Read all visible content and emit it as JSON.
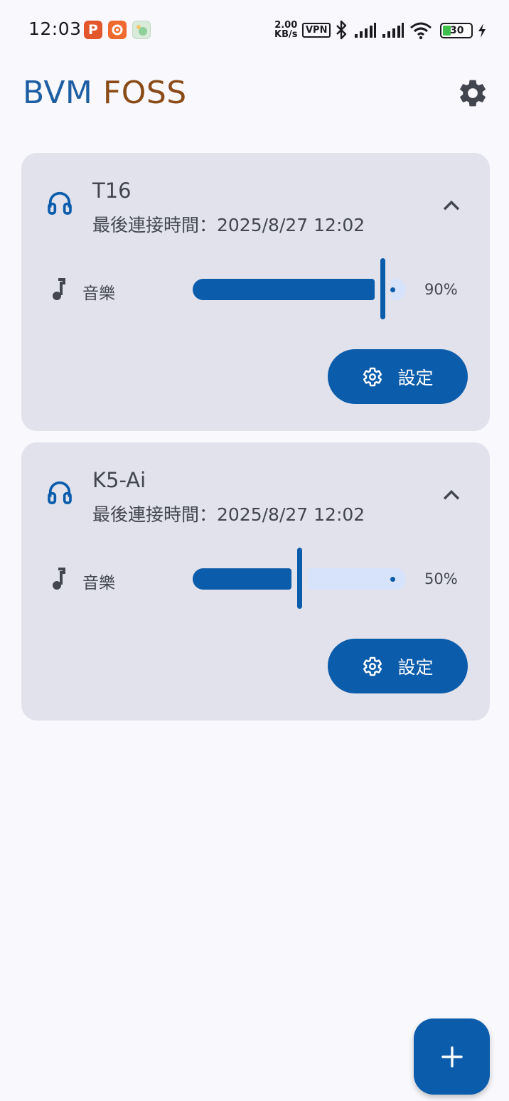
{
  "status_bar": {
    "time": "12:03",
    "net_speed_value": "2.00",
    "net_speed_unit": "KB/s",
    "vpn_label": "VPN",
    "battery": "30",
    "app_icon_1_letter": "P"
  },
  "app_bar": {
    "title_part1": "BVM",
    "title_part2": "FOSS"
  },
  "devices": [
    {
      "name": "T16",
      "last_connected": "最後連接時間：2025/8/27 12:02",
      "channel_label": "音樂",
      "volume_percent": 90,
      "volume_text": "90%",
      "setup_label": "設定",
      "expanded": true
    },
    {
      "name": "K5-Ai",
      "last_connected": "最後連接時間：2025/8/27 12:02",
      "channel_label": "音樂",
      "volume_percent": 50,
      "volume_text": "50%",
      "setup_label": "設定",
      "expanded": true
    }
  ],
  "icons": {
    "settings": "gear-icon",
    "device": "headphones-icon",
    "collapse": "chevron-up-icon",
    "channel": "music-note-icon",
    "setup": "gear-icon",
    "fab": "plus-icon"
  },
  "colors": {
    "primary": "#0b5cab",
    "title_blue": "#1e5fa3",
    "title_brown": "#8a4b17",
    "card_bg": "#e1e2ec",
    "slider_track_inactive": "#d7e2fb",
    "background": "#f8f8fd"
  }
}
